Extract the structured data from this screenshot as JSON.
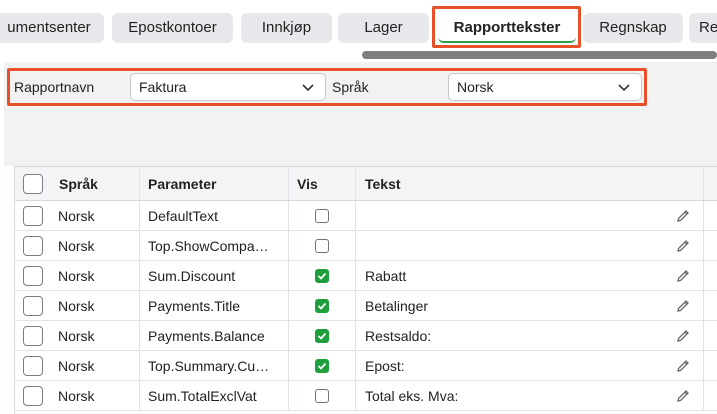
{
  "tabs": [
    {
      "label": "umentsenter",
      "active": false
    },
    {
      "label": "Epostkontoer",
      "active": false
    },
    {
      "label": "Innkjøp",
      "active": false
    },
    {
      "label": "Lager",
      "active": false
    },
    {
      "label": "Rapporttekster",
      "active": true
    },
    {
      "label": "Regnskap",
      "active": false
    },
    {
      "label": "Re",
      "active": false
    }
  ],
  "filters": {
    "report_name_label": "Rapportnavn",
    "report_name_value": "Faktura",
    "language_label": "Språk",
    "language_value": "Norsk"
  },
  "table": {
    "headers": [
      "Språk",
      "Parameter",
      "Vis",
      "Tekst"
    ],
    "rows": [
      {
        "lang": "Norsk",
        "param": "DefaultText",
        "vis": false,
        "text": ""
      },
      {
        "lang": "Norsk",
        "param": "Top.ShowCompa…",
        "vis": false,
        "text": ""
      },
      {
        "lang": "Norsk",
        "param": "Sum.Discount",
        "vis": true,
        "text": "Rabatt"
      },
      {
        "lang": "Norsk",
        "param": "Payments.Title",
        "vis": true,
        "text": "Betalinger"
      },
      {
        "lang": "Norsk",
        "param": "Payments.Balance",
        "vis": true,
        "text": "Restsaldo:"
      },
      {
        "lang": "Norsk",
        "param": "Top.Summary.Cu…",
        "vis": true,
        "text": "Epost:"
      },
      {
        "lang": "Norsk",
        "param": "Sum.TotalExclVat",
        "vis": false,
        "text": "Total eks. Mva:"
      }
    ]
  },
  "colors": {
    "highlight": "#e8502a",
    "check_green": "#1f9e3c",
    "active_tab_underline": "#2e9e47"
  },
  "icons": {
    "dropdown": "chevron-down-icon",
    "edit": "pencil-icon"
  }
}
